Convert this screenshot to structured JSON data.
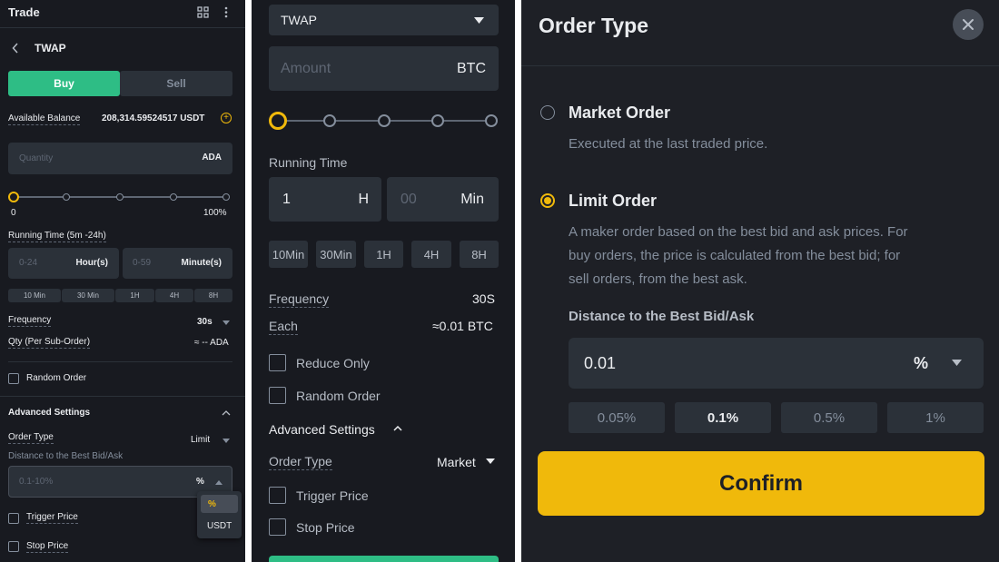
{
  "panel1": {
    "title": "Trade",
    "grid_icon": "grid-icon",
    "more_icon": "more-vertical-icon",
    "back_icon": "chevron-left-icon",
    "strategy": "TWAP",
    "buy_label": "Buy",
    "sell_label": "Sell",
    "available_balance_label": "Available Balance",
    "available_balance_value": "208,314.59524517 USDT",
    "quantity_placeholder": "Quantity",
    "quantity_unit": "ADA",
    "slider": {
      "value": 0,
      "min_label": "0",
      "max_label": "100%"
    },
    "running_time_label": "Running Time (5m -24h)",
    "hours_placeholder": "0-24",
    "hours_unit": "Hour(s)",
    "minutes_placeholder": "0-59",
    "minutes_unit": "Minute(s)",
    "presets": [
      "10 Min",
      "30 Min",
      "1H",
      "4H",
      "8H"
    ],
    "frequency_label": "Frequency",
    "frequency_value": "30s",
    "qty_label": "Qty (Per Sub-Order)",
    "qty_value": "≈ -- ADA",
    "random_order_label": "Random Order",
    "advanced_settings_label": "Advanced Settings",
    "order_type_label": "Order Type",
    "order_type_value": "Limit",
    "distance_label": "Distance to the Best Bid/Ask",
    "distance_placeholder": "0.1-10%",
    "distance_unit": "%",
    "dropdown_options": [
      "%",
      "USDT"
    ],
    "trigger_price_label": "Trigger Price",
    "stop_price_label": "Stop Price"
  },
  "panel2": {
    "strategy": "TWAP",
    "amount_placeholder": "Amount",
    "amount_unit": "BTC",
    "slider": {
      "value": 0
    },
    "running_time_label": "Running Time",
    "hours_value": "1",
    "hours_unit": "H",
    "minutes_placeholder": "00",
    "minutes_unit": "Min",
    "presets": [
      "10Min",
      "30Min",
      "1H",
      "4H",
      "8H"
    ],
    "frequency_label": "Frequency",
    "frequency_value": "30S",
    "each_label": "Each",
    "each_value": "≈0.01 BTC",
    "reduce_only_label": "Reduce Only",
    "random_order_label": "Random Order",
    "advanced_settings_label": "Advanced Settings",
    "order_type_label": "Order Type",
    "order_type_value": "Market",
    "trigger_price_label": "Trigger Price",
    "stop_price_label": "Stop Price"
  },
  "panel3": {
    "title": "Order Type",
    "close_icon": "close-icon",
    "market_order_label": "Market Order",
    "market_order_desc": "Executed at the last traded price.",
    "limit_order_label": "Limit Order",
    "limit_order_desc_1": "A maker order based on the best bid and ask prices. For",
    "limit_order_desc_2": "buy orders, the price is calculated from the best bid; for",
    "limit_order_desc_3": "sell orders, from the best ask.",
    "distance_label": "Distance to the Best Bid/Ask",
    "distance_value": "0.01",
    "distance_unit": "%",
    "presets": [
      "0.05%",
      "0.1%",
      "0.5%",
      "1%"
    ],
    "selected_preset": "0.1%",
    "confirm_label": "Confirm"
  },
  "colors": {
    "accent": "#f0b90b",
    "buy": "#2ebd85",
    "background": "#181a20",
    "field": "#2b3139",
    "text": "#eaecef",
    "muted": "#848e9c"
  }
}
